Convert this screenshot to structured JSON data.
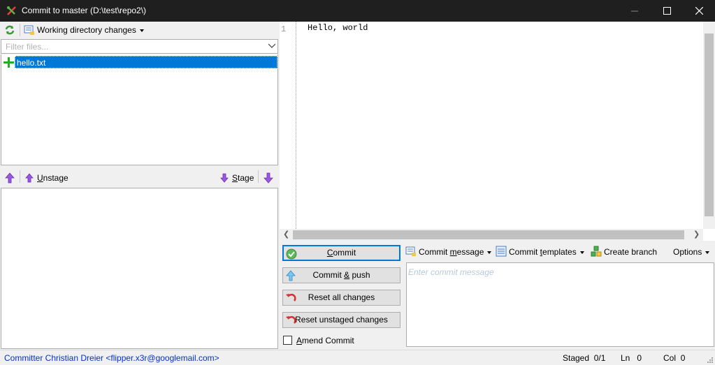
{
  "window": {
    "title": "Commit to master (D:\\test\\repo2\\)"
  },
  "toolbar": {
    "working_dir_label": "Working directory changes"
  },
  "filter": {
    "placeholder": "Filter files..."
  },
  "unstaged_files": [
    {
      "name": "hello.txt",
      "status": "added"
    }
  ],
  "stage_bar": {
    "unstage_prefix": "U",
    "unstage_rest": "nstage",
    "stage_prefix": "S",
    "stage_rest": "tage"
  },
  "editor": {
    "line_number": "1",
    "content": "Hello, world"
  },
  "buttons": {
    "commit_prefix": "C",
    "commit_rest": "ommit",
    "commit_push_prefix": "Commit ",
    "commit_push_mid": "&",
    "commit_push_rest": " push",
    "reset_all": "Reset all changes",
    "reset_unstaged": "Reset unstaged changes",
    "amend_prefix": "A",
    "amend_rest": "mend Commit"
  },
  "message_toolbar": {
    "commit_message_a": "Commit ",
    "commit_message_u": "m",
    "commit_message_b": "essage",
    "commit_templates_a": "Commit ",
    "commit_templates_u": "t",
    "commit_templates_b": "emplates",
    "create_branch": "Create branch",
    "options": "Options"
  },
  "commit_message": {
    "placeholder": "Enter commit message",
    "value": ""
  },
  "status": {
    "committer": "Committer Christian Dreier <flipper.x3r@googlemail.com>",
    "staged_label": "Staged",
    "staged_value": "0/1",
    "ln_label": "Ln",
    "ln_value": "0",
    "col_label": "Col",
    "col_value": "0"
  },
  "colors": {
    "selection": "#0078d7",
    "titlebar": "#1f1f1f",
    "committer_link": "#0033cc"
  }
}
